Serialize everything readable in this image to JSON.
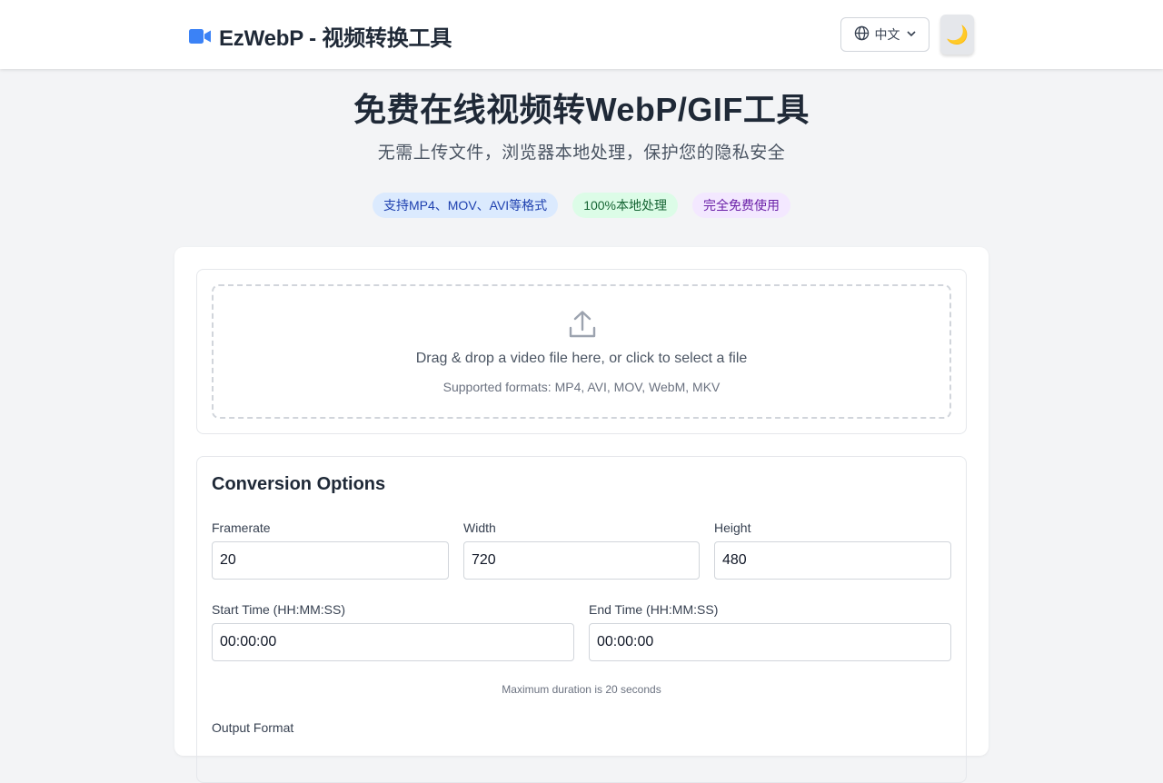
{
  "header": {
    "logo_icon": "video-camera-icon",
    "title": "EzWebP - 视频转换工具",
    "language_label": "中文",
    "language_icon": "globe-icon",
    "theme_toggle_glyph": "🌙",
    "accent_color": "#3b82f6"
  },
  "hero": {
    "title": "免费在线视频转WebP/GIF工具",
    "subtitle": "无需上传文件，浏览器本地处理，保护您的隐私安全",
    "badges": [
      {
        "label": "支持MP4、MOV、AVI等格式",
        "color": "#dbeafe"
      },
      {
        "label": "100%本地处理",
        "color": "#dcfce7"
      },
      {
        "label": "完全免费使用",
        "color": "#f3e8ff"
      }
    ]
  },
  "upload": {
    "icon": "upload-icon",
    "prompt": "Drag & drop a video file here, or click to select a file",
    "formats": "Supported formats: MP4, AVI, MOV, WebM, MKV"
  },
  "options": {
    "title": "Conversion Options",
    "framerate": {
      "label": "Framerate",
      "value": "20"
    },
    "width": {
      "label": "Width",
      "value": "720"
    },
    "height": {
      "label": "Height",
      "value": "480"
    },
    "start_time": {
      "label": "Start Time (HH:MM:SS)",
      "value": "00:00:00"
    },
    "end_time": {
      "label": "End Time (HH:MM:SS)",
      "value": "00:00:00"
    },
    "duration_note": "Maximum duration is 20 seconds",
    "output_format_label": "Output Format"
  }
}
